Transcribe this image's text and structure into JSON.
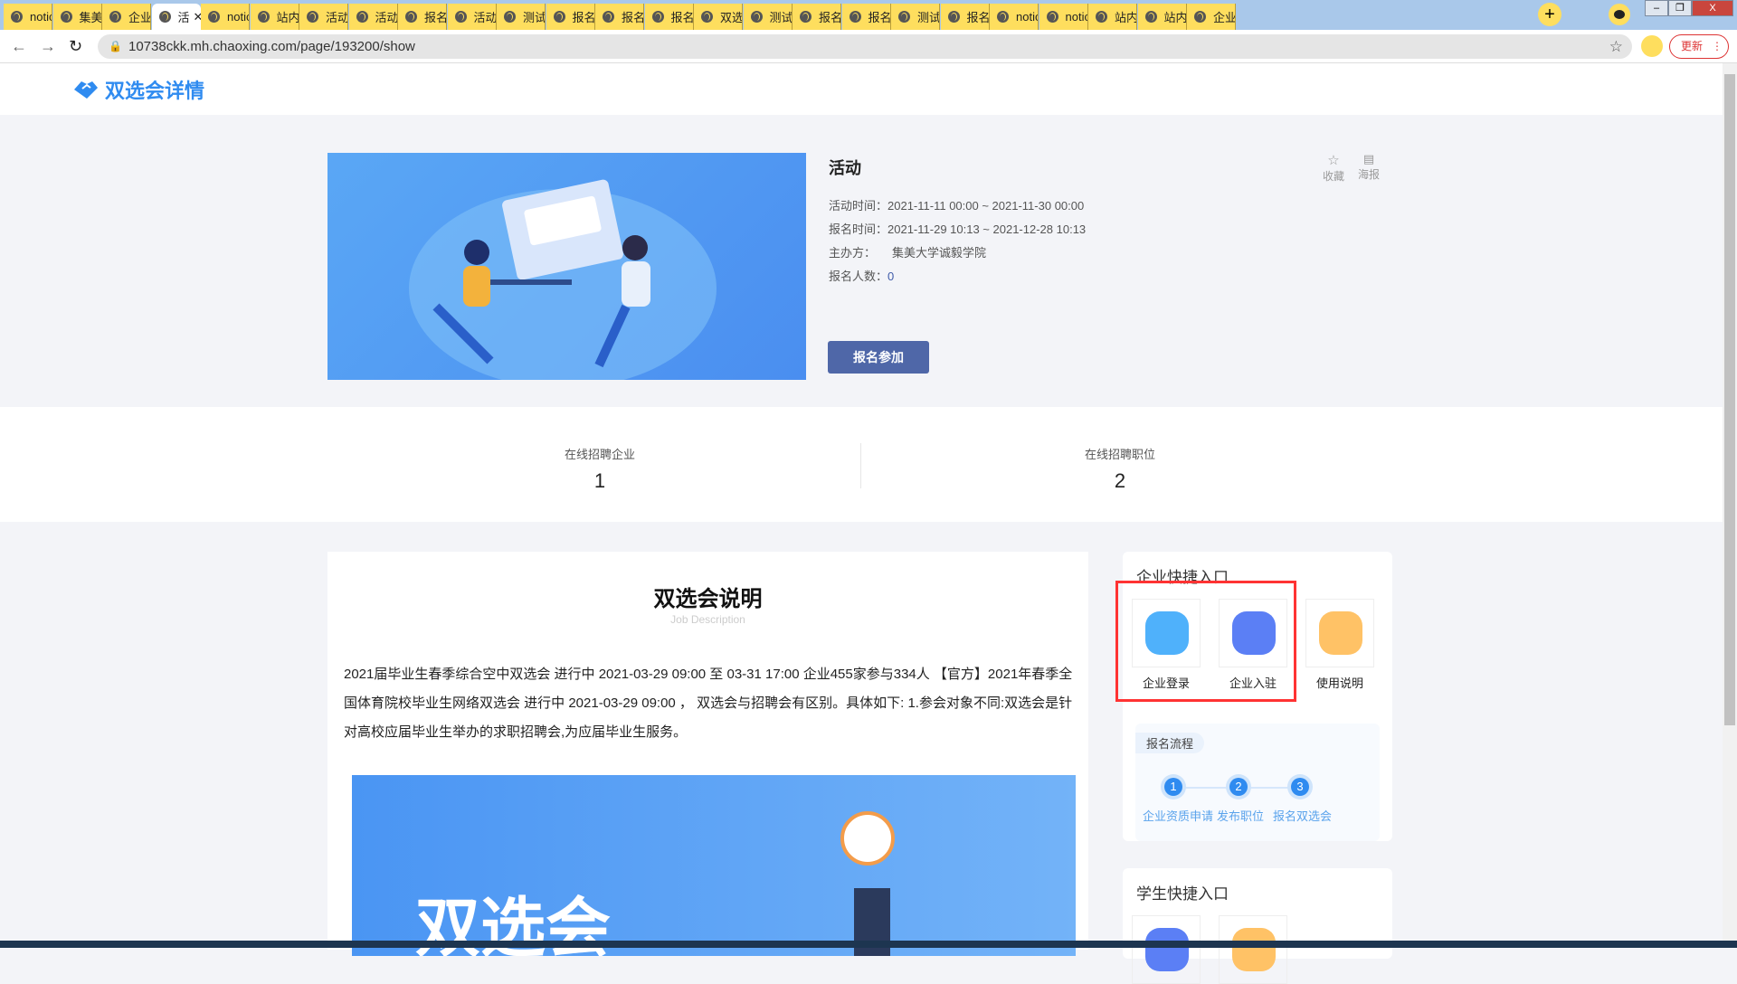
{
  "browser": {
    "tabs": [
      "notic",
      "集美",
      "企业",
      "活",
      "notic",
      "站内",
      "活动",
      "活动",
      "报名",
      "活动",
      "测试",
      "报名",
      "报名",
      "报名",
      "双选",
      "测试",
      "报名",
      "报名",
      "测试",
      "报名",
      "notic",
      "notic",
      "站内",
      "站内",
      "企业"
    ],
    "active_tab_index": 3,
    "new_tab": "+",
    "url": "10738ckk.mh.chaoxing.com/page/193200/show",
    "update_label": "更新"
  },
  "header": {
    "logo_text": "双选会详情"
  },
  "event": {
    "title": "活动",
    "rows": [
      {
        "label": "活动时间：",
        "value": "2021-11-11 00:00  ~ 2021-11-30 00:00"
      },
      {
        "label": "报名时间：",
        "value": "2021-11-29 10:13  ~ 2021-12-28 10:13"
      },
      {
        "label": "主办方：",
        "value": "集美大学诚毅学院"
      },
      {
        "label": "报名人数：",
        "value": "0"
      }
    ],
    "signup_label": "报名参加",
    "favorite_label": "收藏",
    "poster_label": "海报"
  },
  "stats": [
    {
      "label": "在线招聘企业",
      "value": "1"
    },
    {
      "label": "在线招聘职位",
      "value": "2"
    }
  ],
  "description": {
    "title": "双选会说明",
    "subtitle": "Job Description",
    "body": "2021届毕业生春季综合空中双选会 进行中 2021-03-29 09:00 至 03-31 17:00 企业455家参与334人 【官方】2021年春季全国体育院校毕业生网络双选会 进行中 2021-03-29 09:00 ， 双选会与招聘会有区别。具体如下: 1.参会对象不同:双选会是针对高校应届毕业生举办的求职招聘会,为应届毕业生服务。",
    "image_text": "双选会"
  },
  "enterprise": {
    "title": "企业快捷入口",
    "tiles": [
      {
        "label": "企业登录",
        "color": "#4fb1fb"
      },
      {
        "label": "企业入驻",
        "color": "#5b7ff5"
      },
      {
        "label": "使用说明",
        "color": "#ffc266"
      }
    ],
    "process_title": "报名流程",
    "steps": [
      {
        "num": "1",
        "label": "企业资质申请"
      },
      {
        "num": "2",
        "label": "发布职位"
      },
      {
        "num": "3",
        "label": "报名双选会"
      }
    ]
  },
  "student": {
    "title": "学生快捷入口"
  }
}
